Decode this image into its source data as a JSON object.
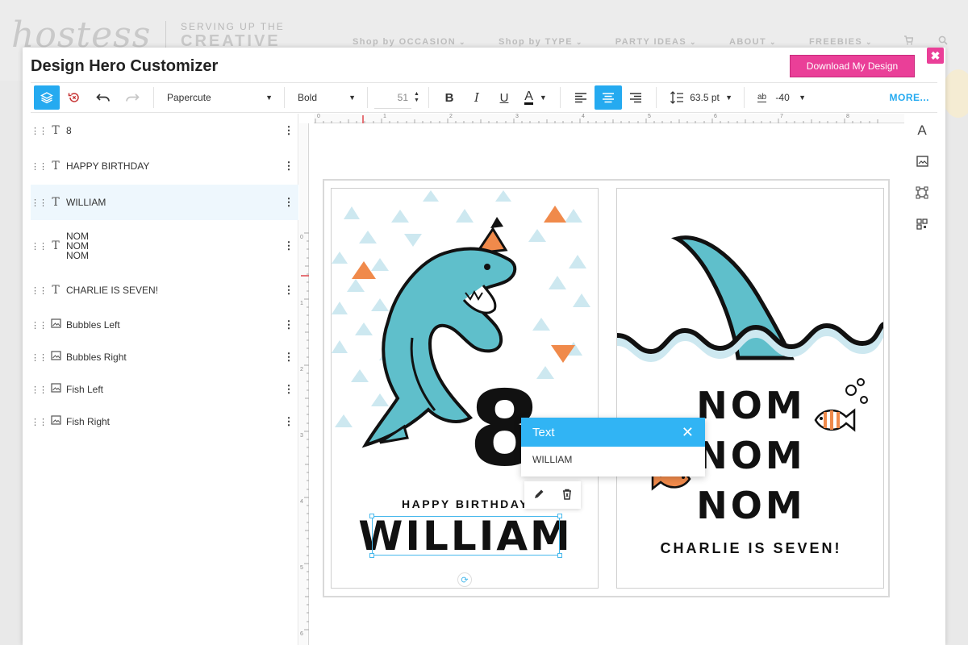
{
  "site": {
    "logo": "hostess",
    "tagline_top": "SERVING UP THE",
    "tagline_bottom": "CREATIVE",
    "nav": [
      "Shop by OCCASION",
      "Shop by TYPE",
      "PARTY IDEAS",
      "ABOUT",
      "FREEBIES"
    ]
  },
  "modal": {
    "title": "Design Hero Customizer",
    "download_label": "Download My Design",
    "close_glyph": "✖"
  },
  "toolbar": {
    "font_family": "Papercute",
    "font_weight": "Bold",
    "font_size": "51",
    "bold_glyph": "B",
    "italic_glyph": "I",
    "underline_glyph": "U",
    "color_glyph": "A",
    "line_height": "63.5 pt",
    "letter_spacing_icon": "ab",
    "letter_spacing": "-40",
    "more_label": "MORE...",
    "text_color": "#111111"
  },
  "layers": [
    {
      "type": "text",
      "label": "8"
    },
    {
      "type": "text",
      "label": "HAPPY BIRTHDAY"
    },
    {
      "type": "text",
      "label": "WILLIAM",
      "active": true
    },
    {
      "type": "text",
      "label": "NOM\nNOM\nNOM"
    },
    {
      "type": "text",
      "label": "CHARLIE IS SEVEN!"
    },
    {
      "type": "image",
      "label": "Bubbles Left"
    },
    {
      "type": "image",
      "label": "Bubbles Right"
    },
    {
      "type": "image",
      "label": "Fish Left"
    },
    {
      "type": "image",
      "label": "Fish Right"
    }
  ],
  "ruler": {
    "top": [
      "0",
      "1",
      "2",
      "3",
      "4",
      "5",
      "6",
      "7",
      "8"
    ],
    "left": [
      "0",
      "1",
      "2",
      "3",
      "4",
      "5",
      "6"
    ]
  },
  "card_left": {
    "age": "8",
    "greeting": "HAPPY BIRTHDAY",
    "name": "WILLIAM"
  },
  "card_right": {
    "nom": [
      "NOM",
      "NOM",
      "NOM"
    ],
    "subtitle": "CHARLIE IS SEVEN!"
  },
  "popup": {
    "title": "Text",
    "value": "WILLIAM"
  },
  "colors": {
    "accent": "#25aaf0",
    "download_button": "#ea3f98",
    "shark": "#5fbfcb",
    "triangle_light": "#cde8f0",
    "triangle_orange": "#f08a4b"
  },
  "rail": [
    "text-tool-icon",
    "image-tool-icon",
    "shape-tool-icon",
    "qr-code-tool-icon"
  ]
}
